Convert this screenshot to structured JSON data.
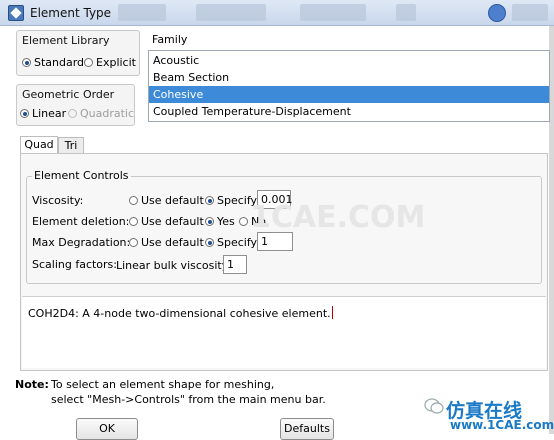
{
  "window": {
    "title": "Element Type",
    "icons": {
      "app": "abaqus-icon",
      "help": "help-icon"
    }
  },
  "element_library": {
    "title": "Element Library",
    "options": [
      {
        "label": "Standard",
        "selected": true
      },
      {
        "label": "Explicit",
        "selected": false
      }
    ]
  },
  "geometric_order": {
    "title": "Geometric Order",
    "options": [
      {
        "label": "Linear",
        "selected": true,
        "disabled": false
      },
      {
        "label": "Quadratic",
        "selected": false,
        "disabled": true
      }
    ]
  },
  "family": {
    "title": "Family",
    "items": [
      "Acoustic",
      "Beam Section",
      "Cohesive",
      "Coupled Temperature-Displacement"
    ],
    "selected": "Cohesive",
    "selection_color": "#3d8ad8"
  },
  "tabs": [
    "Quad",
    "Tri"
  ],
  "active_tab": "Quad",
  "element_controls": {
    "title": "Element Controls",
    "viscosity": {
      "label": "Viscosity:",
      "use_default": "Use default",
      "specify": "Specify",
      "value": "0.001"
    },
    "element_deletion": {
      "label": "Element deletion:",
      "use_default": "Use default",
      "yes": "Yes",
      "no": "No"
    },
    "max_degradation": {
      "label": "Max Degradation:",
      "use_default": "Use default",
      "specify": "Specify",
      "value": "1"
    },
    "scaling_factors": {
      "label": "Scaling factors:",
      "sub_label": "Linear bulk viscosity:",
      "value": "1"
    }
  },
  "description": "COH2D4: A 4-node two-dimensional cohesive element.",
  "note": {
    "label": "Note:",
    "line1": "To select an element shape for meshing,",
    "line2": "select \"Mesh->Controls\" from the main menu bar."
  },
  "buttons": {
    "ok": "OK",
    "defaults": "Defaults"
  },
  "watermark": {
    "chinese": "仿真在线",
    "url": "www.1CAE.com",
    "bg": "1CAE.COM"
  }
}
